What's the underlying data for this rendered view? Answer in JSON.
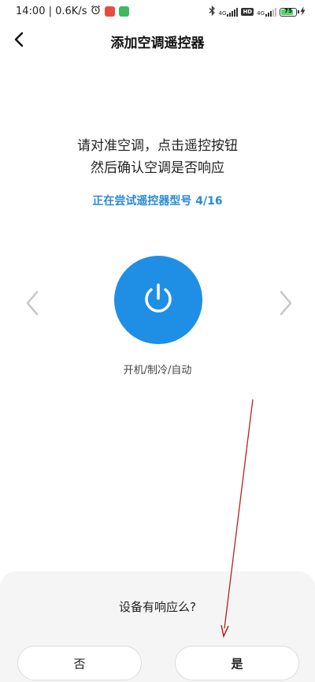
{
  "status_bar": {
    "time_speed": "14:00 | 0.6K/s",
    "signal_label_1": "4G",
    "signal_label_2": "4G",
    "hd_label": "HD",
    "battery_level": "75",
    "battery_fraction": 0.75,
    "icons": [
      "alarm-clock-icon",
      "red-app-icon",
      "green-app-icon",
      "bluetooth-icon",
      "signal-icon",
      "battery-icon",
      "charging-icon"
    ]
  },
  "header": {
    "title": "添加空调遥控器",
    "back_icon": "chevron-left-icon"
  },
  "instructions": {
    "line1": "请对准空调，点击遥控按钮",
    "line2": "然后确认空调是否响应"
  },
  "trying": "正在尝试遥控器型号 4/16",
  "power": {
    "icon": "power-icon",
    "mode_label": "开机/制冷/自动"
  },
  "nav": {
    "prev_icon": "chevron-left-icon",
    "next_icon": "chevron-right-icon"
  },
  "sheet": {
    "question": "设备有响应么?",
    "no_label": "否",
    "yes_label": "是"
  },
  "colors": {
    "accent": "#1f8fe6",
    "link_text": "#2a8bd6",
    "annotation_arrow": "#b22222"
  }
}
